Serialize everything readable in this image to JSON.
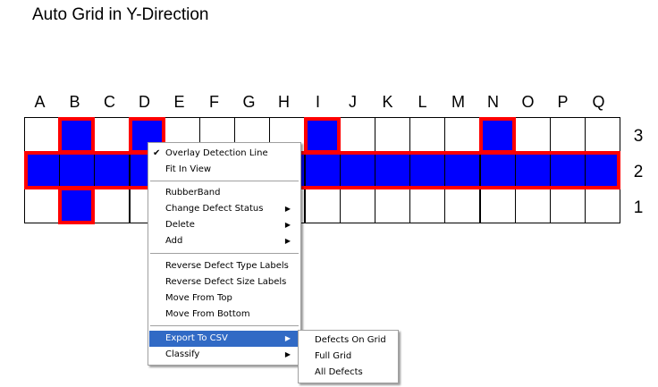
{
  "title": "Auto Grid in Y-Direction",
  "grid": {
    "columns": [
      "A",
      "B",
      "C",
      "D",
      "E",
      "F",
      "G",
      "H",
      "I",
      "J",
      "K",
      "L",
      "M",
      "N",
      "O",
      "P",
      "Q"
    ],
    "rows": [
      "3",
      "2",
      "1"
    ],
    "cell_color_on": "#0000ff",
    "cell_color_off": "#ffffff",
    "outline_color": "#ff0000",
    "filled": {
      "3": [
        "B",
        "D",
        "I",
        "N"
      ],
      "2": [
        "A",
        "B",
        "C",
        "D",
        "E",
        "F",
        "G",
        "H",
        "I",
        "J",
        "K",
        "L",
        "M",
        "N",
        "O",
        "P",
        "Q"
      ],
      "1": [
        "B"
      ]
    }
  },
  "context_menu": {
    "items": [
      {
        "label": "Overlay Detection Line",
        "checked": true
      },
      {
        "label": "Fit In View"
      },
      {
        "label": "RubberBand"
      },
      {
        "label": "Change Defect Status",
        "submenu": true
      },
      {
        "label": "Delete",
        "submenu": true
      },
      {
        "label": "Add",
        "submenu": true
      },
      {
        "label": "Reverse Defect Type Labels"
      },
      {
        "label": "Reverse Defect Size Labels"
      },
      {
        "label": "Move From Top"
      },
      {
        "label": "Move From Bottom"
      },
      {
        "label": "Export To CSV",
        "submenu": true,
        "highlighted": true
      },
      {
        "label": "Classify",
        "submenu": true
      }
    ],
    "highlight_color": "#316ac5",
    "check_icon": "checkmark-icon",
    "arrow_icon": "submenu-arrow-icon"
  },
  "submenu": {
    "items": [
      {
        "label": "Defects On Grid"
      },
      {
        "label": "Full Grid"
      },
      {
        "label": "All Defects"
      }
    ]
  }
}
